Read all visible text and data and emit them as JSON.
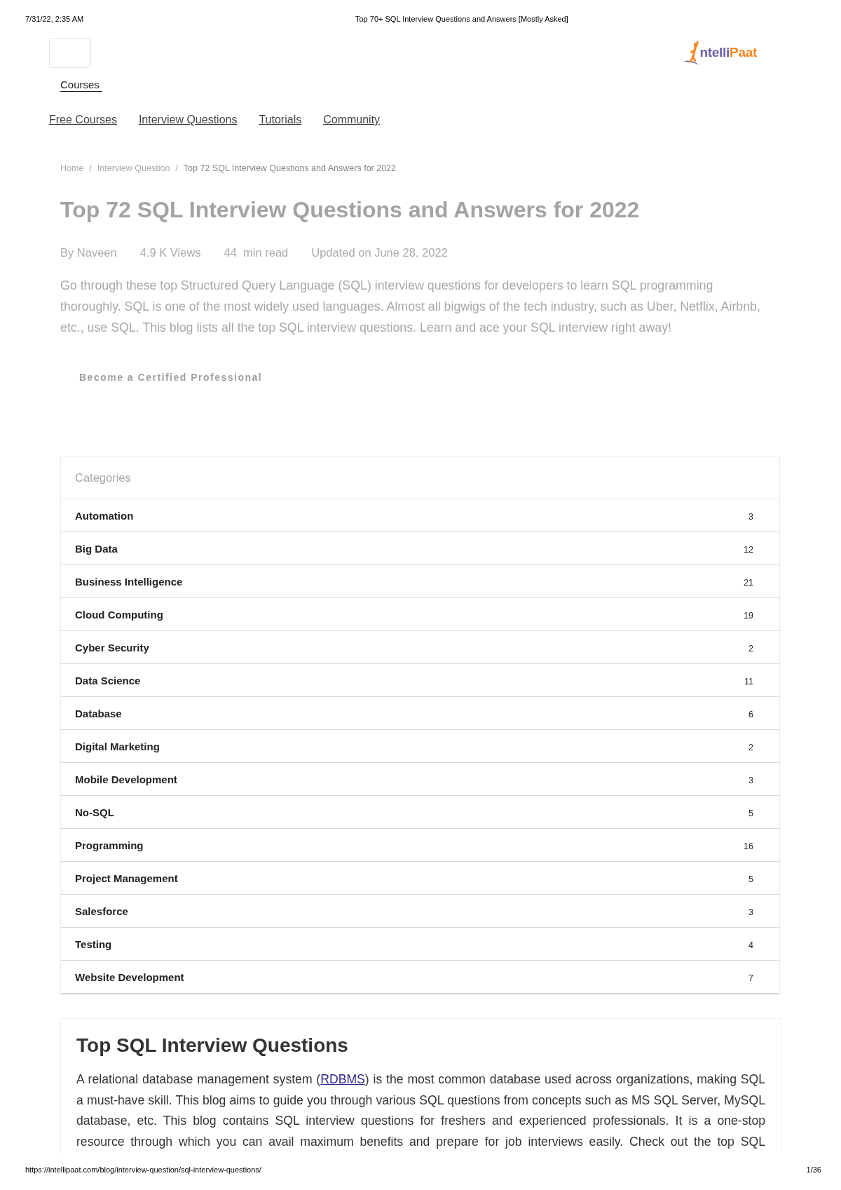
{
  "print_header": {
    "date": "7/31/22, 2:35 AM",
    "title": "Top 70+ SQL Interview Questions and Answers [Mostly Asked]"
  },
  "header": {
    "logo_text": [
      {
        "text": "ntelli",
        "color": "#6b63a8"
      },
      {
        "text": "Paat",
        "color": "#f7861e"
      }
    ],
    "courses_link": "Courses",
    "nav_links": [
      "Free Courses",
      "Interview Questions",
      "Tutorials",
      "Community"
    ]
  },
  "breadcrumb": [
    {
      "label": "Home",
      "current": false
    },
    {
      "label": "Interview Question",
      "separator": "/",
      "current": false
    },
    {
      "label": "Top 72 SQL Interview Questions and Answers for 2022",
      "separator": "/",
      "current": true
    }
  ],
  "article": {
    "title": "Top 72 SQL Interview Questions and Answers for 2022",
    "meta": [
      "By Naveen",
      "4.9 K Views",
      "44  min read",
      "Updated on June 28, 2022"
    ],
    "intro": "Go through these top Structured Query Language (SQL) interview questions for developers to learn SQL programming thoroughly. SQL is one of the most widely used languages. Almost all bigwigs of the tech industry, such as Uber, Netflix, Airbnb, etc., use SQL. This blog lists all the top SQL interview questions. Learn and ace your SQL interview right away!",
    "cta": "Become a Certified Professional"
  },
  "categories": {
    "title": "Categories",
    "items": [
      {
        "name": "Automation",
        "count": "3"
      },
      {
        "name": "Big Data",
        "count": "12"
      },
      {
        "name": "Business Intelligence",
        "count": "21"
      },
      {
        "name": "Cloud Computing",
        "count": "19"
      },
      {
        "name": "Cyber Security",
        "count": "2"
      },
      {
        "name": "Data Science",
        "count": "11"
      },
      {
        "name": "Database",
        "count": "6"
      },
      {
        "name": "Digital Marketing",
        "count": "2"
      },
      {
        "name": "Mobile Development",
        "count": "3"
      },
      {
        "name": "No-SQL",
        "count": "5"
      },
      {
        "name": "Programming",
        "count": "16"
      },
      {
        "name": "Project Management",
        "count": "5"
      },
      {
        "name": "Salesforce",
        "count": "3"
      },
      {
        "name": "Testing",
        "count": "4"
      },
      {
        "name": "Website Development",
        "count": "7"
      }
    ]
  },
  "section": {
    "heading": "Top SQL Interview Questions",
    "text_before_link": "A relational database management system (",
    "link": "RDBMS",
    "text_after_link": ") is the most common database used across organizations, making SQL a must-have skill. This blog aims to guide you through various SQL questions from concepts such as MS SQL Server, MySQL database, etc. This blog contains SQL interview questions for freshers and experienced professionals. It is a one-stop resource through which you can avail maximum benefits and prepare for job interviews easily. Check out the top SQL"
  },
  "print_footer": {
    "url": "https://intellipaat.com/blog/interview-question/sql-interview-questions/",
    "page": "1/36"
  }
}
